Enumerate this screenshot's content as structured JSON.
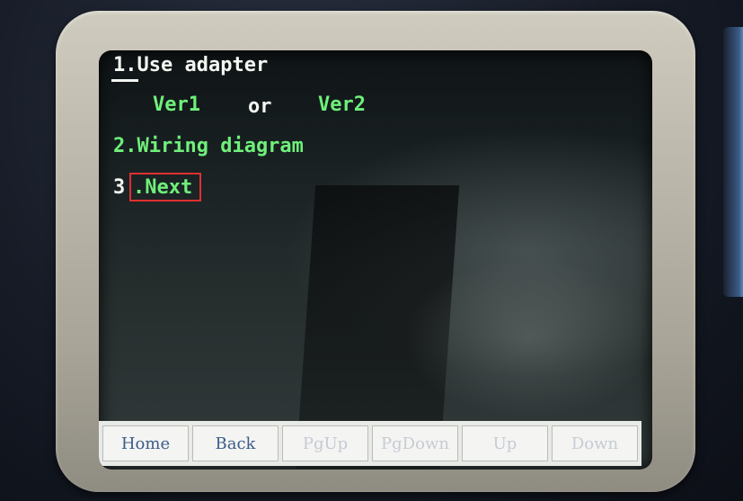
{
  "menu": {
    "item1": "1.Use adapter",
    "ver1": "Ver1",
    "or": "or",
    "ver2": "Ver2",
    "item2": "2.Wiring diagram",
    "item3_num": "3",
    "item3_label": ".Next"
  },
  "toolbar": {
    "buttons": [
      {
        "label": "Home",
        "enabled": true
      },
      {
        "label": "Back",
        "enabled": true
      },
      {
        "label": "PgUp",
        "enabled": false
      },
      {
        "label": "PgDown",
        "enabled": false
      },
      {
        "label": "Up",
        "enabled": false
      },
      {
        "label": "Down",
        "enabled": false
      }
    ]
  },
  "colors": {
    "menu_text_selected": "#f4f6f2",
    "menu_text": "#6ff07a",
    "highlight_box": "#e03030",
    "toolbar_text": "#3c5c8a"
  }
}
